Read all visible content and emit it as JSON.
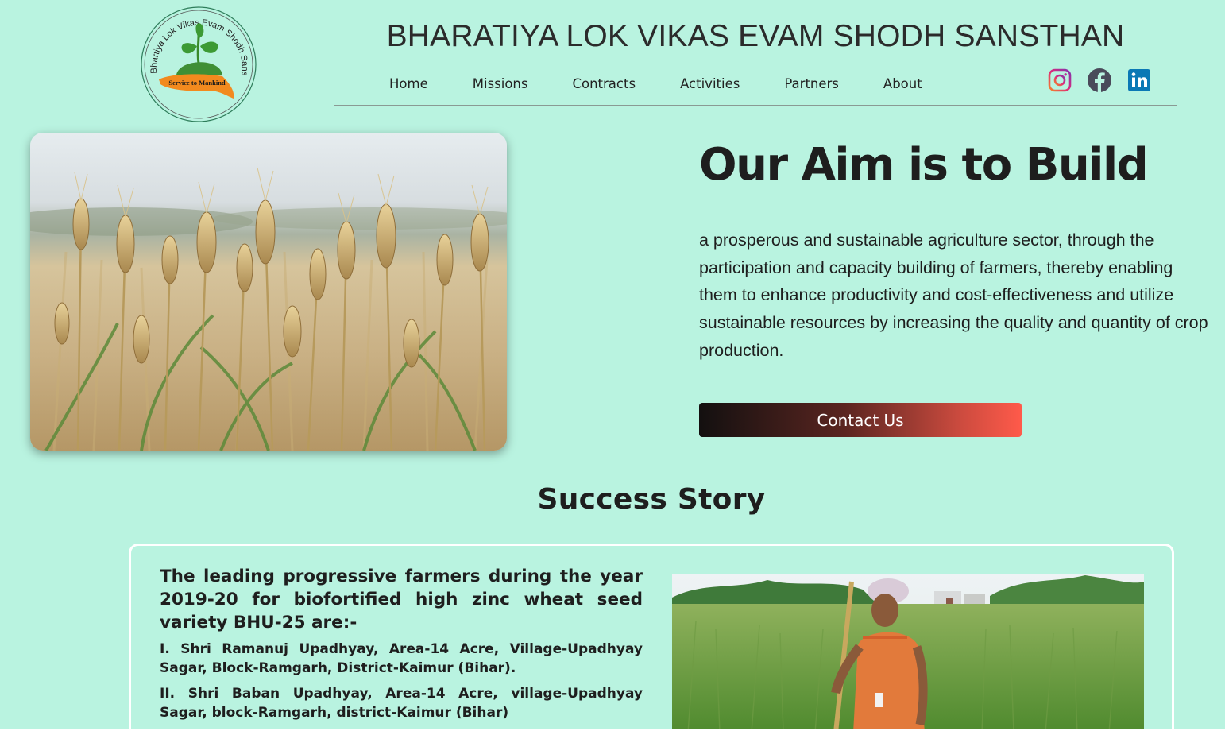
{
  "header": {
    "logo": {
      "ring_text": "Bhartiya Lok Vikas Evam Shodh Sansthan",
      "tagline": "Service to Mankind"
    },
    "site_title": "BHARATIYA LOK VIKAS EVAM SHODH SANSTHAN",
    "nav": [
      {
        "label": "Home"
      },
      {
        "label": "Missions"
      },
      {
        "label": "Contracts"
      },
      {
        "label": "Activities"
      },
      {
        "label": "Partners"
      },
      {
        "label": "About"
      }
    ],
    "social": [
      {
        "icon": "instagram-icon",
        "color": "#c13584"
      },
      {
        "icon": "facebook-icon",
        "color": "#4a4a5a"
      },
      {
        "icon": "linkedin-icon",
        "color": "#0a78b5"
      }
    ]
  },
  "hero": {
    "heading": "Our Aim is to Build",
    "text": "a prosperous and sustainable agriculture sector, through the participation and capacity building of farmers, thereby enabling them to enhance productivity and cost-effectiveness and utilize sustainable resources by increasing the quality and quantity of crop production.",
    "button_label": "Contact Us"
  },
  "success": {
    "heading": "Success Story",
    "title": "The leading progressive farmers during the year 2019-20 for biofortified high zinc wheat seed variety BHU-25 are:-",
    "items": [
      "I. Shri Ramanuj Upadhyay, Area-14 Acre, Village-Upadhyay Sagar, Block-Ramgarh, District-Kaimur (Bihar).",
      "II. Shri Baban Upadhyay, Area-14 Acre, village-Upadhyay Sagar, block-Ramgarh, district-Kaimur (Bihar)"
    ]
  },
  "colors": {
    "background": "#b9f3e0",
    "button_gradient_start": "#131010",
    "button_gradient_end": "#ff5a4a"
  }
}
